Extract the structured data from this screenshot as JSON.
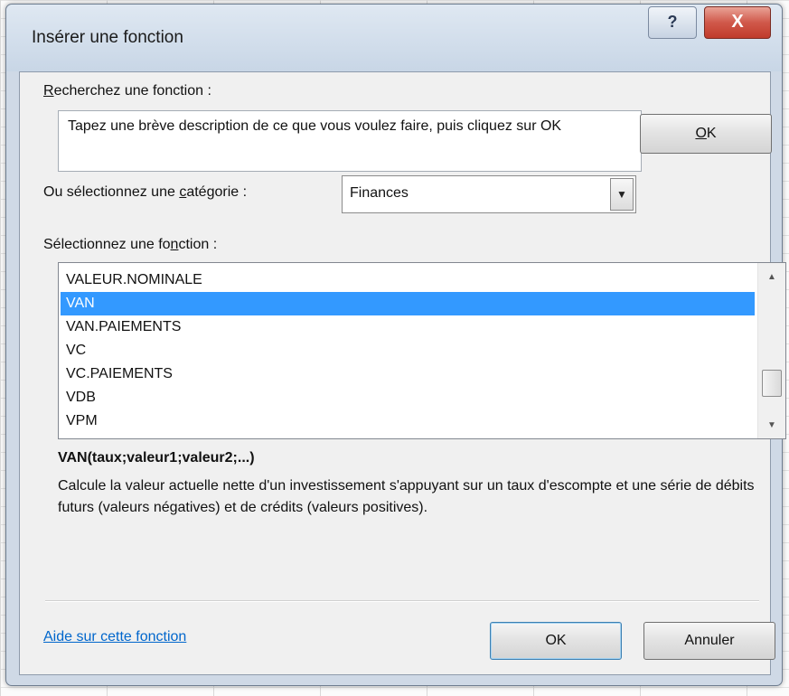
{
  "window": {
    "title": "Insérer une fonction",
    "help_icon": "question-mark-icon",
    "help_glyph": "?",
    "close_icon": "close-x-icon",
    "close_glyph": "X"
  },
  "search": {
    "label_prefix": "",
    "label_mnemonic": "R",
    "label_rest": "echerchez une fonction :",
    "text": "Tapez une brève description de ce que vous voulez faire, puis cliquez sur OK",
    "ok_mnemonic": "O",
    "ok_rest": "K"
  },
  "category": {
    "label_prefix": "Ou sélectionnez une ",
    "label_mnemonic": "c",
    "label_rest": "atégorie :",
    "value": "Finances"
  },
  "function_list": {
    "label_prefix": "Sélectionnez une fo",
    "label_mnemonic": "n",
    "label_rest": "ction :",
    "items": [
      "VALEUR.NOMINALE",
      "VAN",
      "VAN.PAIEMENTS",
      "VC",
      "VC.PAIEMENTS",
      "VDB",
      "VPM"
    ],
    "selected_index": 1
  },
  "details": {
    "signature": "VAN(taux;valeur1;valeur2;...)",
    "description": "Calcule la valeur actuelle nette d'un investissement s'appuyant sur un taux d'escompte et une série de débits futurs (valeurs négatives) et de crédits (valeurs positives)."
  },
  "footer": {
    "help_link": "Aide sur cette fonction",
    "ok_label": "OK",
    "cancel_label": "Annuler"
  },
  "colors": {
    "selection": "#3399ff",
    "link": "#0066cc",
    "close_button": "#c03b2b"
  }
}
